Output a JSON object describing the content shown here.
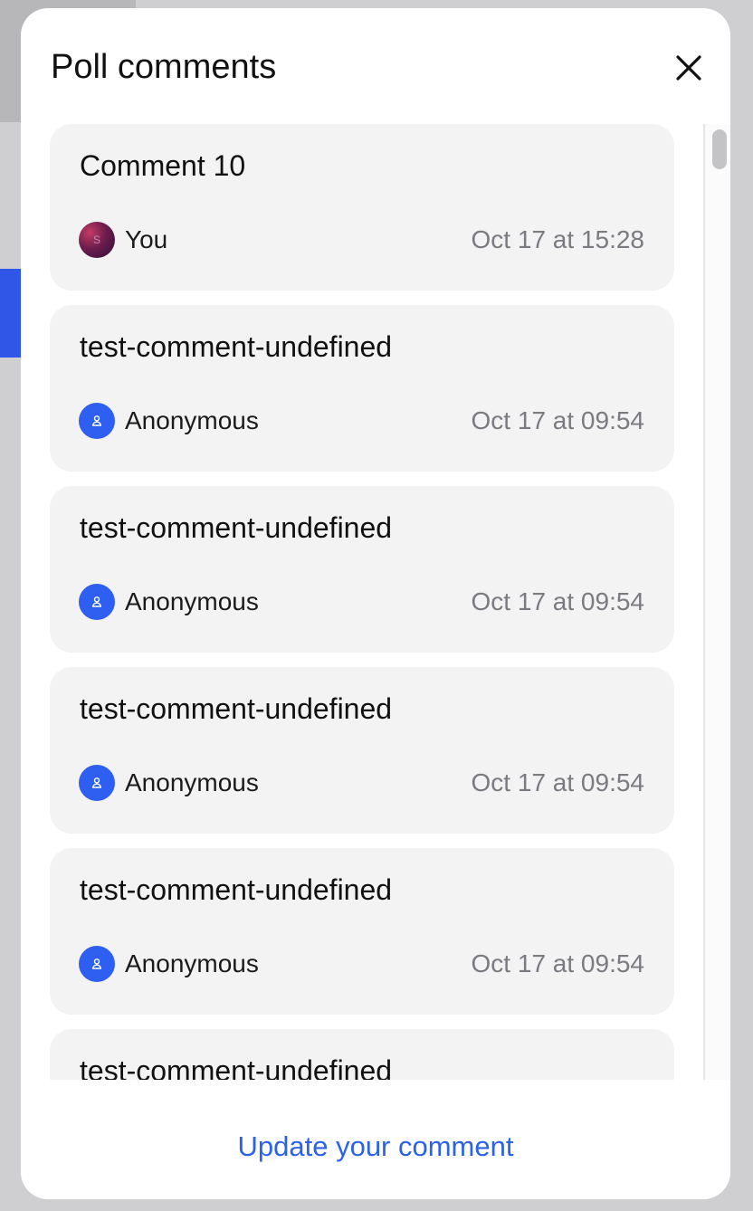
{
  "modal": {
    "title": "Poll comments",
    "close_icon": "close-icon",
    "footer_action": "Update your comment"
  },
  "comments": [
    {
      "text": "Comment 10",
      "author": "You",
      "avatar_letter": "S",
      "avatar_type": "user-photo",
      "time": "Oct 17 at 15:28"
    },
    {
      "text": "test-comment-undefined",
      "author": "Anonymous",
      "avatar_type": "anonymous-user-icon",
      "time": "Oct 17 at 09:54"
    },
    {
      "text": "test-comment-undefined",
      "author": "Anonymous",
      "avatar_type": "anonymous-user-icon",
      "time": "Oct 17 at 09:54"
    },
    {
      "text": "test-comment-undefined",
      "author": "Anonymous",
      "avatar_type": "anonymous-user-icon",
      "time": "Oct 17 at 09:54"
    },
    {
      "text": "test-comment-undefined",
      "author": "Anonymous",
      "avatar_type": "anonymous-user-icon",
      "time": "Oct 17 at 09:54"
    },
    {
      "text": "test-comment-undefined"
    }
  ],
  "colors": {
    "accent": "#2c62e8",
    "anonymous_avatar": "#2f5ff0",
    "card_background": "#f3f3f4",
    "timestamp": "#7a7a80"
  }
}
